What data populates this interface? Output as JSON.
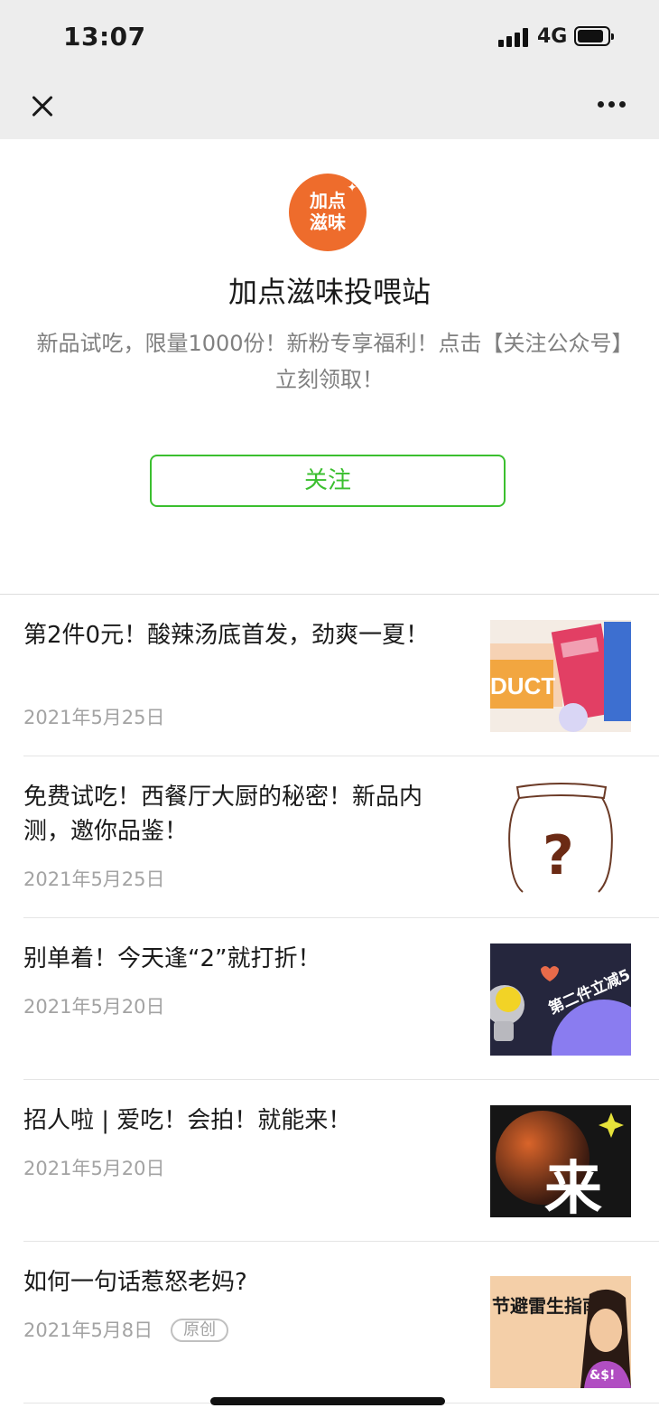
{
  "status_bar": {
    "time": "13:07",
    "network": "4G"
  },
  "account": {
    "logo_text": "加点滋味",
    "name": "加点滋味投喂站",
    "description": "新品试吃，限量1000份！新粉专享福利！点击【关注公众号】立刻领取！",
    "follow_label": "关注"
  },
  "articles": [
    {
      "title": "第2件0元！酸辣汤底首发，劲爽一夏！",
      "date": "2021年5月25日",
      "thumb_text": "DUCT",
      "thumb_icon": "product-photo"
    },
    {
      "title": "免费试吃！西餐厅大厨的秘密！新品内测，邀你品鉴！",
      "date": "2021年5月25日",
      "thumb_text": "?",
      "thumb_icon": "mystery-jar"
    },
    {
      "title": "别单着！今天逢“2”就打折！",
      "date": "2021年5月20日",
      "thumb_text": "第二件立减5",
      "thumb_icon": "astronaut"
    },
    {
      "title": "招人啦 | 爱吃！会拍！就能来！",
      "date": "2021年5月20日",
      "thumb_text": "来",
      "thumb_icon": "planet"
    },
    {
      "title": "如何一句话惹怒老妈?",
      "date": "2021年5月8日",
      "badge": "原创",
      "thumb_text": "节避雷生指南",
      "thumb_text_line2": "&$!",
      "thumb_icon": "woman-emoji"
    }
  ],
  "colors": {
    "accent_green": "#3bbf2f",
    "logo_orange": "#ee6c2c",
    "nav_bg": "#ededed"
  }
}
